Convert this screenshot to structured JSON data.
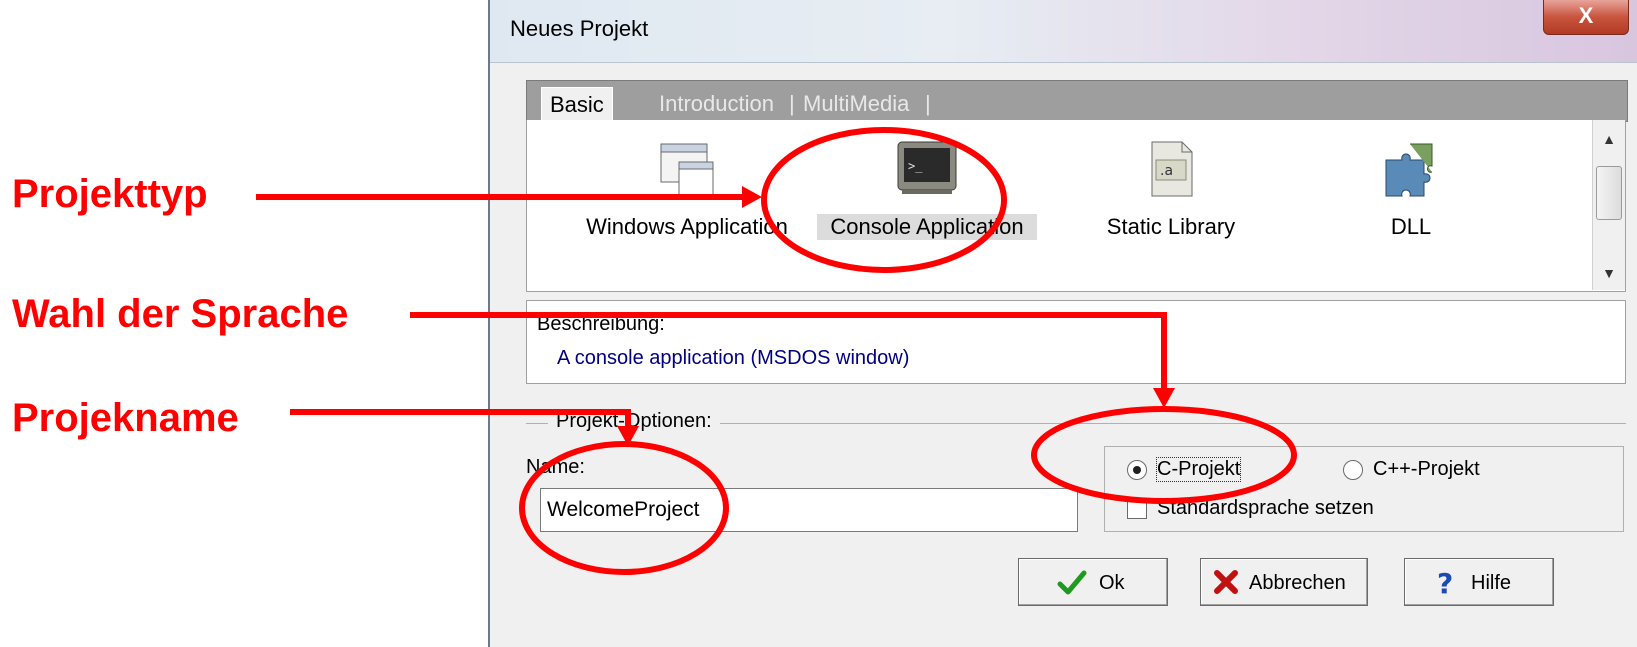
{
  "annotations": {
    "projekttyp": "Projekttyp",
    "sprache": "Wahl der Sprache",
    "projektname": "Projekname",
    "color": "#ff0000"
  },
  "dialog": {
    "title": "Neues Projekt",
    "close_label": "X",
    "tabs": [
      {
        "label": "Basic",
        "selected": true
      },
      {
        "label": "Introduction",
        "selected": false
      },
      {
        "label": "MultiMedia",
        "selected": false
      }
    ],
    "tab_separator": "|",
    "templates": [
      {
        "label": "Windows Application",
        "icon": "window-icon"
      },
      {
        "label": "Console Application",
        "icon": "console-icon",
        "selected": true
      },
      {
        "label": "Static Library",
        "icon": "library-icon"
      },
      {
        "label": "DLL",
        "icon": "puzzle-icon"
      }
    ],
    "description": {
      "label": "Beschreibung:",
      "text": "A console application (MSDOS window)"
    },
    "options": {
      "legend": "Projekt-Optionen:",
      "name_label": "Name:",
      "name_value": "WelcomeProject",
      "radio_c": "C-Projekt",
      "radio_cpp": "C++-Projekt",
      "selected_language": "C-Projekt",
      "default_language_label": "Standardsprache setzen",
      "default_language_checked": false
    },
    "buttons": {
      "ok": "Ok",
      "cancel": "Abbrechen",
      "help": "Hilfe"
    }
  }
}
